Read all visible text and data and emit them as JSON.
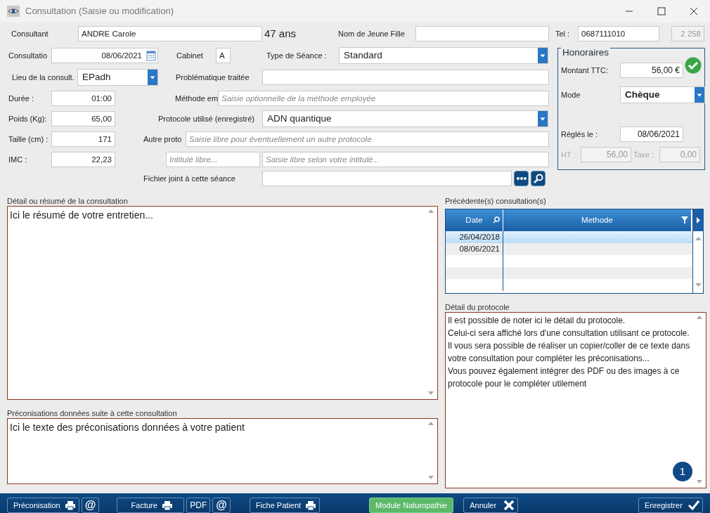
{
  "window": {
    "title": "Consultation (Saisie ou modification)"
  },
  "header_row": [
    {
      "kind": "label",
      "text": "Consultant",
      "disabled": false
    },
    {
      "kind": "field",
      "value": "ANDRE Carole",
      "disabled": false
    },
    {
      "kind": "static",
      "text": "47 ans",
      "disabled": false
    },
    {
      "kind": "label",
      "text": "Nom de Jeune Fille",
      "disabled": false
    },
    {
      "kind": "field",
      "disabled": false
    },
    {
      "kind": "label",
      "text": "Tel :",
      "disabled": false
    },
    {
      "kind": "field",
      "value": "0687111010",
      "disabled": false
    },
    {
      "kind": "field",
      "value": "2 258",
      "disabled": true
    }
  ],
  "form_rows": [
    [
      {
        "kind": "label",
        "text": "Consultatio"
      },
      {
        "kind": "date",
        "value": "08/06/2021"
      },
      {
        "kind": "label",
        "text": "Cabinet"
      },
      {
        "kind": "field",
        "value": "A"
      },
      {
        "kind": "label",
        "text": "Type de Séance :"
      },
      {
        "kind": "select",
        "value": "Standard"
      }
    ],
    [
      {
        "kind": "label",
        "text": "Lieu de la consult."
      },
      {
        "kind": "select",
        "value": "EPadh"
      },
      {
        "kind": "label",
        "text": "Problématique traitée"
      },
      {
        "kind": "field"
      }
    ],
    [
      {
        "kind": "label",
        "text": "Durée :"
      },
      {
        "kind": "field",
        "value": "01:00"
      },
      {
        "kind": "label",
        "text": "Méthode em"
      },
      {
        "kind": "field",
        "placeholder": "Saisie optionnelle de la méthode employée"
      }
    ],
    [
      {
        "kind": "label",
        "text": "Poids (Kg):"
      },
      {
        "kind": "field",
        "value": "65,00"
      },
      {
        "kind": "label",
        "text": "Protocole utilisé (enregistré)"
      },
      {
        "kind": "select",
        "value": "ADN quantique"
      }
    ],
    [
      {
        "kind": "label",
        "text": "Taille (cm) :"
      },
      {
        "kind": "field",
        "value": "171"
      },
      {
        "kind": "label",
        "text": "Autre proto"
      },
      {
        "kind": "field",
        "placeholder": "Saisie libre pour éventuellement un autre protocole"
      }
    ],
    [
      {
        "kind": "label",
        "text": "IMC :"
      },
      {
        "kind": "field",
        "value": "22,23"
      },
      {
        "kind": "field",
        "placeholder": "Intitulé libre..."
      },
      {
        "kind": "field",
        "placeholder": "Saisie libre selon votre intitulé..."
      }
    ],
    [
      {
        "kind": "label",
        "text": "Fichier joint à cette séance"
      },
      {
        "kind": "field"
      },
      {
        "kind": "button"
      },
      {
        "kind": "button"
      }
    ]
  ],
  "fees": {
    "title": "Honoraires",
    "paid": true,
    "rows": [
      [
        {
          "kind": "label",
          "text": "Montant TTC:",
          "disabled": false
        },
        {
          "kind": "field",
          "value": "56,00 €",
          "disabled": false
        }
      ],
      [
        {
          "kind": "label",
          "text": "Mode",
          "disabled": false
        },
        {
          "kind": "select",
          "value": "Chèque",
          "disabled": false
        }
      ],
      [
        {
          "kind": "label",
          "text": "Réglés le :",
          "disabled": false
        },
        {
          "kind": "field",
          "value": "08/06/2021",
          "disabled": false
        }
      ],
      [
        {
          "kind": "label",
          "text": "HT :",
          "disabled": true
        },
        {
          "kind": "field",
          "value": "56,00",
          "disabled": true
        },
        {
          "kind": "label",
          "text": "Taxe :",
          "disabled": true
        },
        {
          "kind": "field",
          "value": "0,00",
          "disabled": true
        }
      ]
    ]
  },
  "summary": {
    "label": "Détail ou résumé de la consultation",
    "value": "Ici le résumé de votre entretien..."
  },
  "advice": {
    "label": "Préconisations données suite à cette consultation",
    "value": "Ici le texte des préconisations données à votre patient"
  },
  "history": {
    "label": "Précédente(s) consultation(s)",
    "columns": [
      "Date",
      "Methode"
    ],
    "rows": [
      {
        "date": "26/04/2018",
        "selected": true
      },
      {
        "date": "08/06/2021",
        "selected": false
      }
    ]
  },
  "protocol": {
    "label": "Détail du protocole",
    "value": "Il est possible de noter ici le détail du protocole.\nCelui-ci sera affiché lors d'une consultation utilisant ce protocole. Il vous sera possible de réaliser un copier/coller de ce texte dans votre consultation pour compléter les préconisations...\nVous pouvez également intégrer des PDF ou des images à ce protocole pour le compléter utilement",
    "badge": "1"
  },
  "footer_buttons": [
    {
      "label": "Préconisation",
      "kind": "print"
    },
    {
      "label": "@",
      "kind": "text"
    },
    {
      "label": "Facture",
      "kind": "print"
    },
    {
      "label": "PDF",
      "kind": "text"
    },
    {
      "label": "@",
      "kind": "text"
    },
    {
      "label": "Fiche Patient",
      "kind": "print"
    },
    {
      "label": "Module Naturopathie",
      "kind": "accent"
    },
    {
      "label": "Annuler",
      "kind": "cancel"
    },
    {
      "label": "Enregistrer",
      "kind": "save"
    }
  ]
}
